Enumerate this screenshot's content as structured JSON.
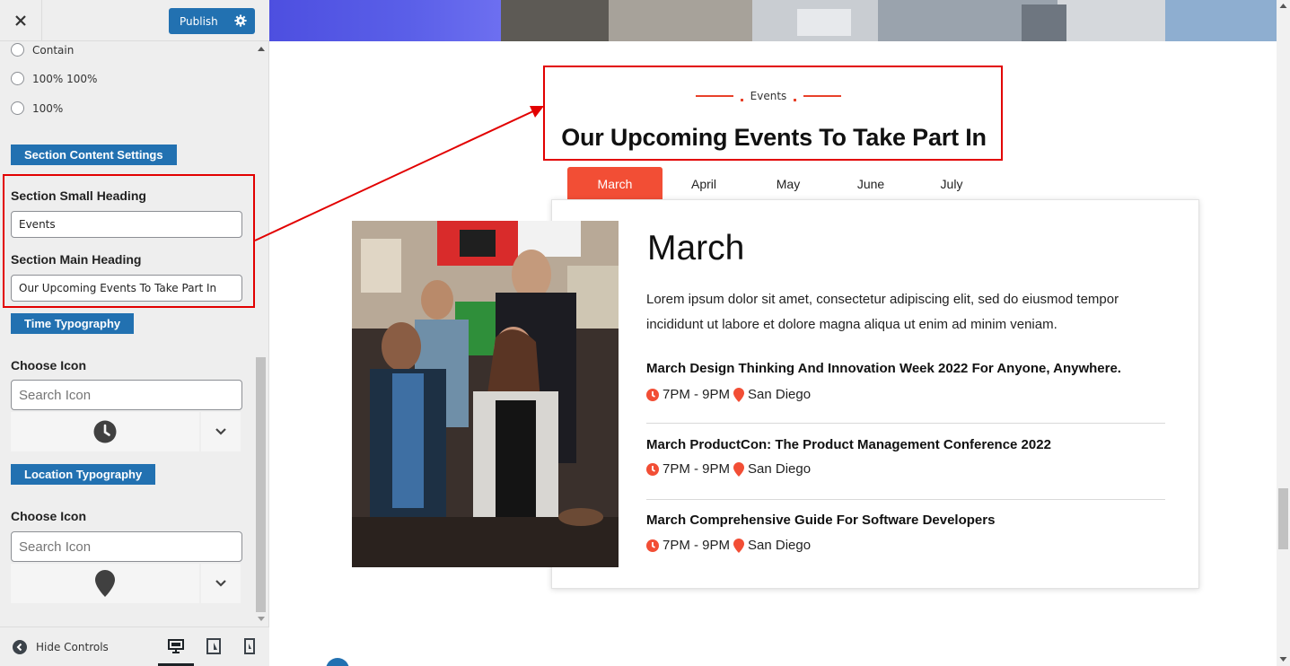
{
  "sidebar": {
    "close_icon": "close-icon",
    "publish_label": "Publish",
    "radio_options": [
      "Contain",
      "100% 100%",
      "100%"
    ],
    "section_content_settings": "Section Content Settings",
    "small_heading_label": "Section Small Heading",
    "small_heading_value": "Events",
    "main_heading_label": "Section Main Heading",
    "main_heading_value": "Our Upcoming Events To Take Part In",
    "time_typography": "Time Typography",
    "choose_icon_1": "Choose Icon",
    "search_placeholder_1": "Search Icon",
    "time_icon": "clock-icon",
    "location_typography": "Location Typography",
    "choose_icon_2": "Choose Icon",
    "search_placeholder_2": "Search Icon",
    "location_icon": "map-marker-icon",
    "hide_controls": "Hide Controls",
    "devices": [
      "desktop",
      "tablet",
      "mobile"
    ]
  },
  "preview": {
    "small_heading": "Events",
    "main_heading": "Our Upcoming Events To Take Part In",
    "tabs": [
      "March",
      "April",
      "May",
      "June",
      "July"
    ],
    "active_tab": "March",
    "month_title": "March",
    "description": "Lorem ipsum dolor sit amet, consectetur adipiscing elit, sed do eiusmod tempor incididunt ut labore et dolore magna aliqua ut enim ad minim veniam.",
    "events": [
      {
        "title": "March Design Thinking And Innovation Week 2022 For Anyone, Anywhere.",
        "time": "7PM - 9PM",
        "location": "San Diego"
      },
      {
        "title": "March ProductCon: The Product Management Conference 2022",
        "time": "7PM - 9PM",
        "location": "San Diego"
      },
      {
        "title": "March Comprehensive Guide For Software Developers",
        "time": "7PM - 9PM",
        "location": "San Diego"
      }
    ]
  },
  "colors": {
    "accent_blue": "#2271b1",
    "accent_red": "#f24e35",
    "annotation_red": "#e20000"
  }
}
